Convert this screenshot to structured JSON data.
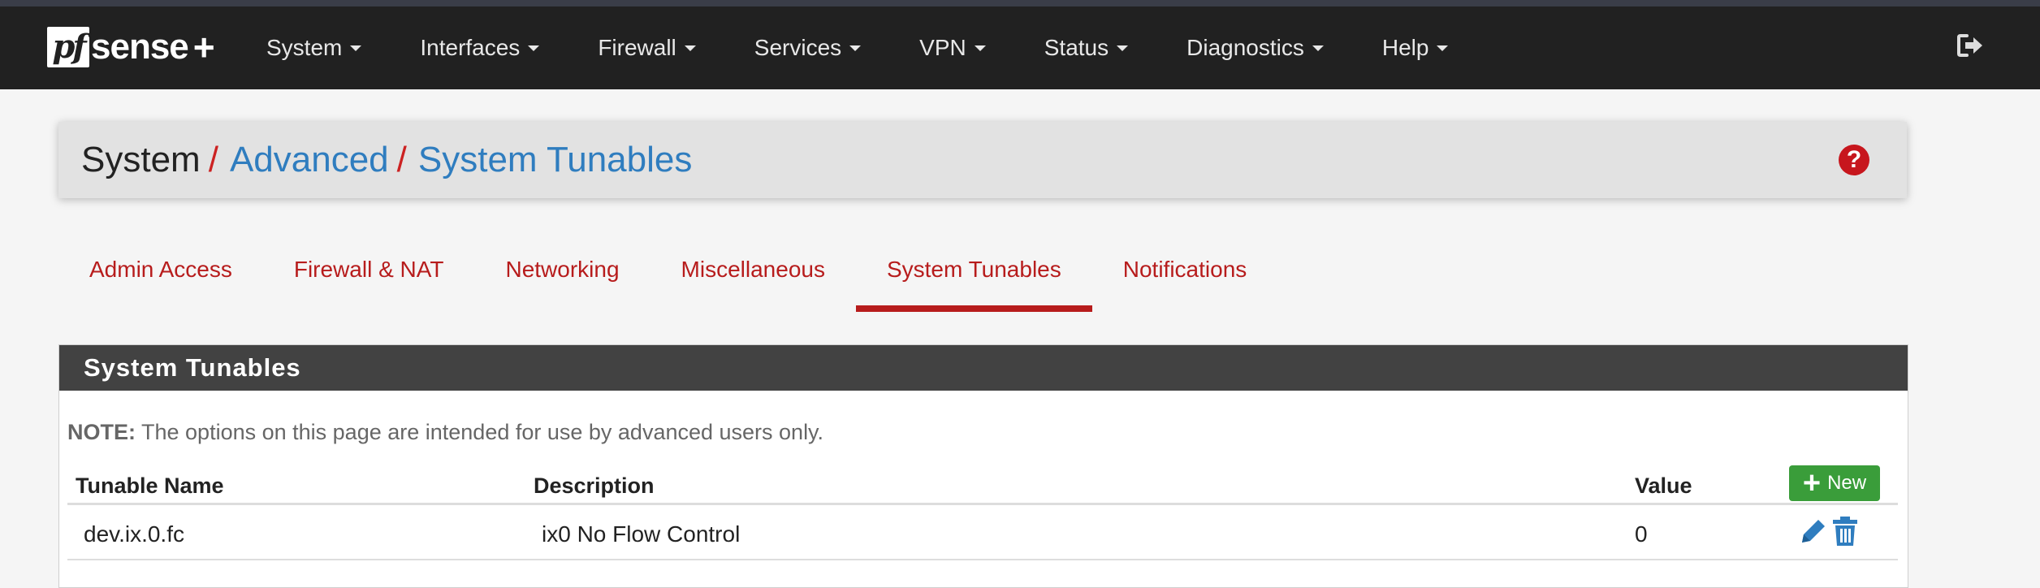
{
  "brand": {
    "logo_pf": "pf",
    "logo_sense": "sense",
    "logo_plus": "+"
  },
  "nav": {
    "items": [
      {
        "label": "System"
      },
      {
        "label": "Interfaces"
      },
      {
        "label": "Firewall"
      },
      {
        "label": "Services"
      },
      {
        "label": "VPN"
      },
      {
        "label": "Status"
      },
      {
        "label": "Diagnostics"
      },
      {
        "label": "Help"
      }
    ],
    "logout_icon": "sign-out-icon"
  },
  "breadcrumb": {
    "root": "System",
    "separator": "/",
    "level2": "Advanced",
    "current": "System Tunables",
    "help_label": "?"
  },
  "tabs": [
    {
      "label": "Admin Access"
    },
    {
      "label": "Firewall & NAT"
    },
    {
      "label": "Networking"
    },
    {
      "label": "Miscellaneous"
    },
    {
      "label": "System Tunables",
      "active": true
    },
    {
      "label": "Notifications"
    }
  ],
  "panel": {
    "heading": "System Tunables",
    "note_label": "NOTE:",
    "note_text": " The options on this page are intended for use by advanced users only.",
    "columns": {
      "name": "Tunable Name",
      "description": "Description",
      "value": "Value"
    },
    "new_button": "New",
    "rows": [
      {
        "name": "dev.ix.0.fc",
        "description": "ix0 No Flow Control",
        "value": "0"
      }
    ]
  },
  "colors": {
    "navbar": "#212121",
    "accent_red": "#b71c1c",
    "link_blue": "#2f7dbf",
    "heading_dark": "#424242",
    "new_green": "#3a9d3a"
  }
}
